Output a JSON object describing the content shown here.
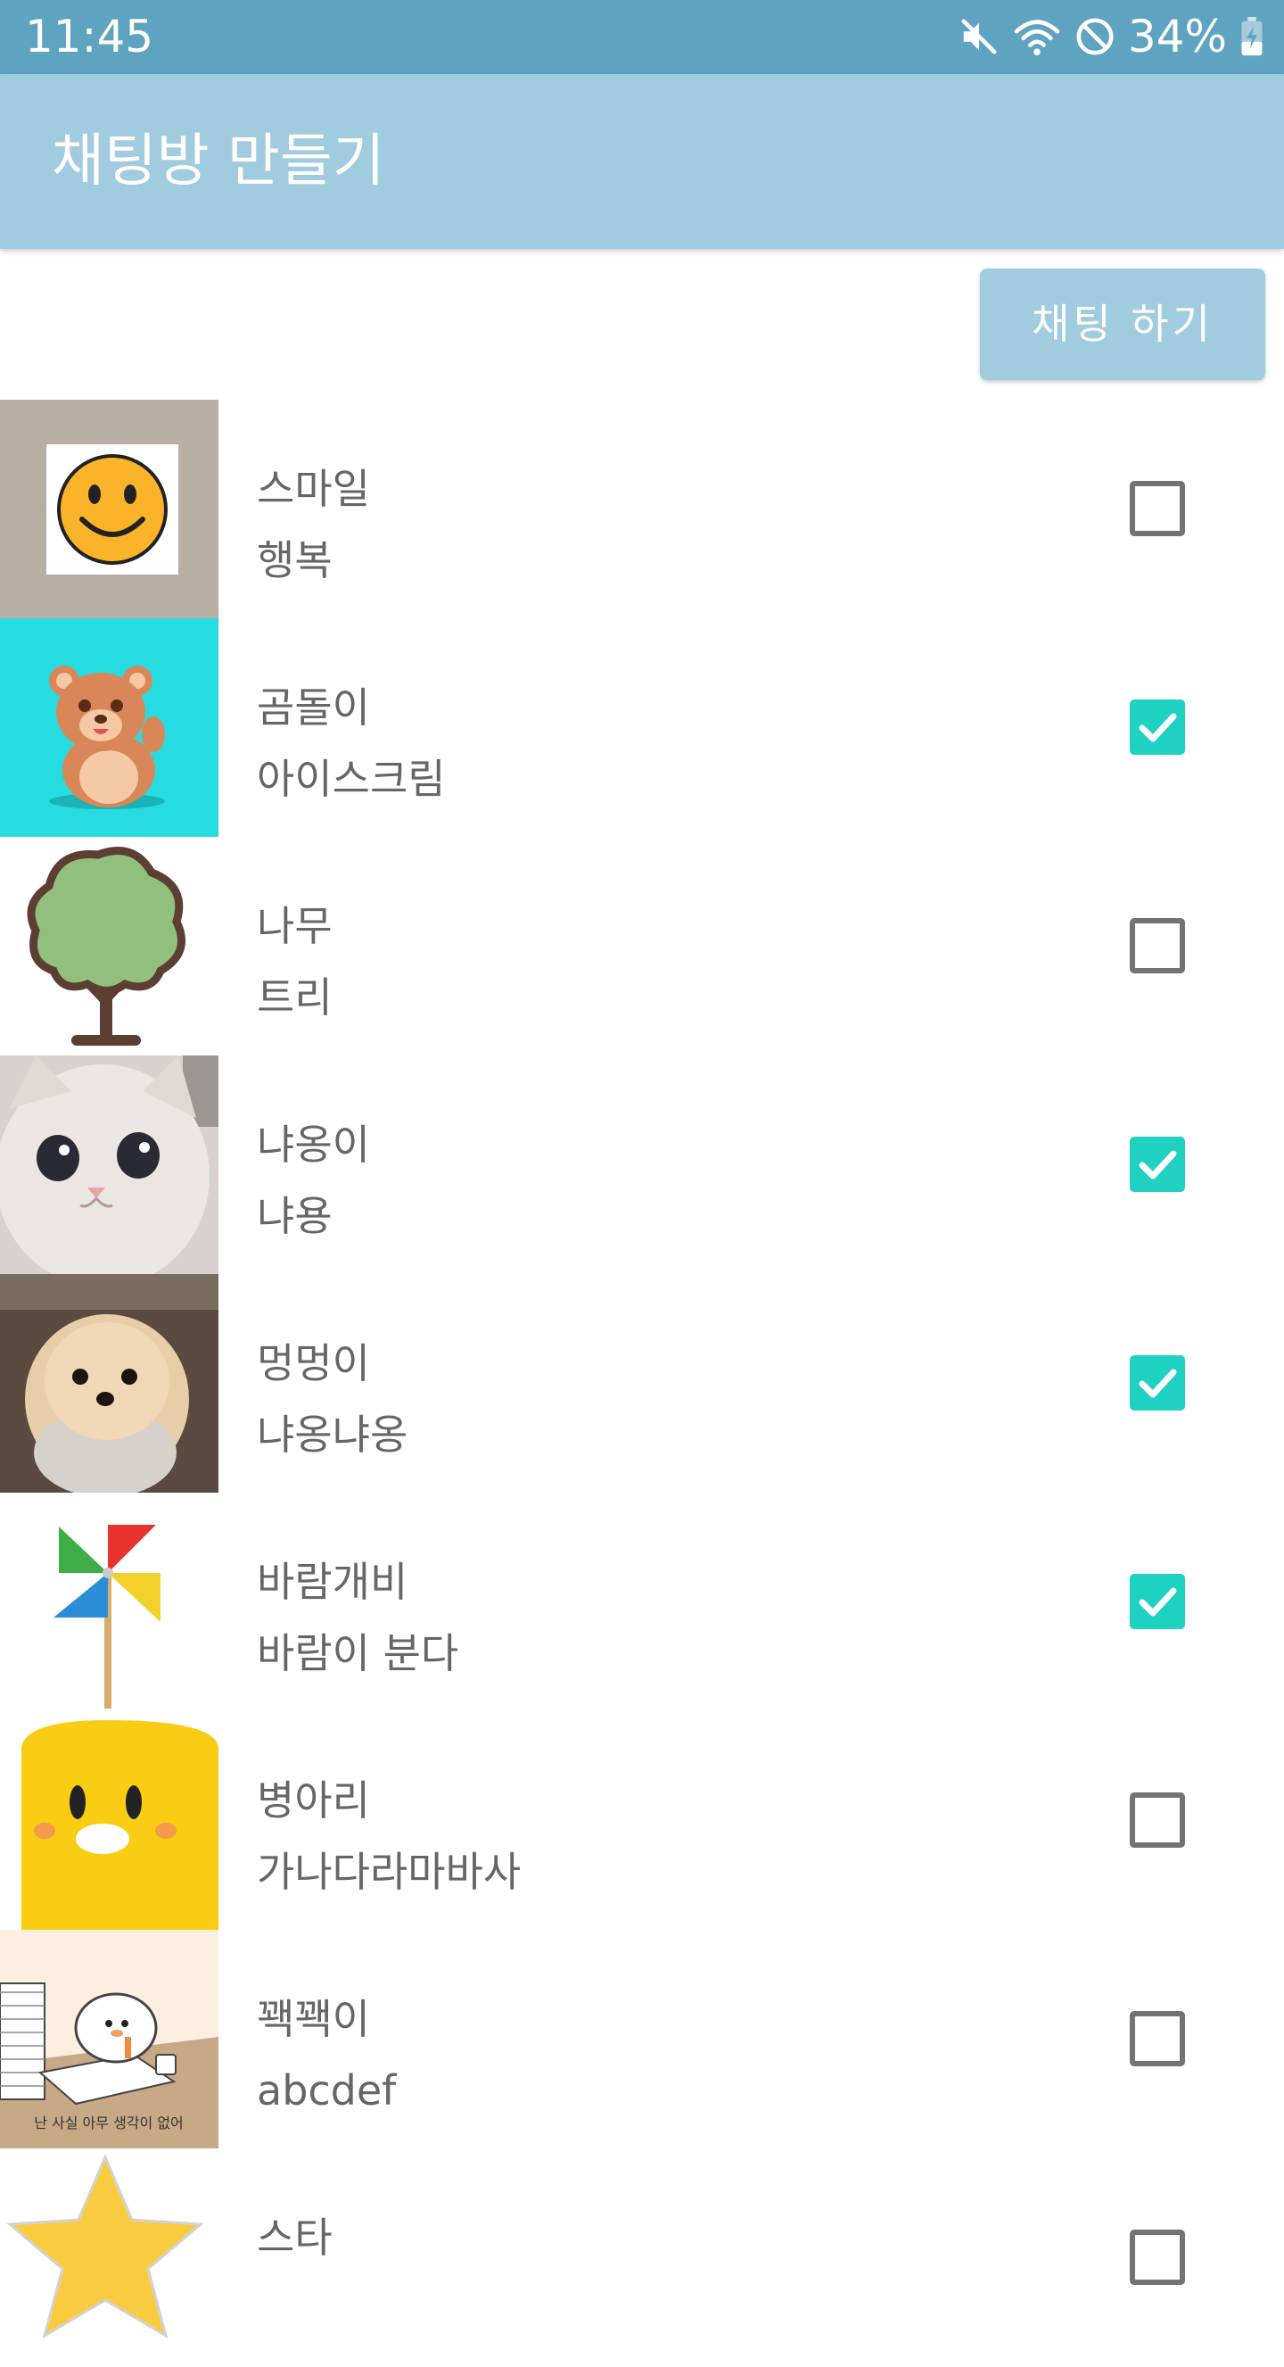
{
  "status_bar": {
    "time": "11:45",
    "battery": "34%",
    "icons": [
      "mute-icon",
      "wifi-icon",
      "block-icon",
      "battery-charging-icon"
    ]
  },
  "app_bar": {
    "title": "채팅방 만들기"
  },
  "actions": {
    "chat_button_label": "채팅 하기"
  },
  "colors": {
    "status_bar": "#5ea3c0",
    "app_bar": "#a1cce0",
    "checkbox_checked": "#1fd1c1",
    "text": "#666666"
  },
  "friends": [
    {
      "name": "스마일",
      "status": "행복",
      "checked": false,
      "avatar": "smiley-face-icon"
    },
    {
      "name": "곰돌이",
      "status": "아이스크림",
      "checked": true,
      "avatar": "teddy-bear-icon"
    },
    {
      "name": "나무",
      "status": "트리",
      "checked": false,
      "avatar": "tree-icon"
    },
    {
      "name": "냐옹이",
      "status": "냐용",
      "checked": true,
      "avatar": "cat-photo"
    },
    {
      "name": "멍멍이",
      "status": "냐옹냐옹",
      "checked": true,
      "avatar": "dog-photo"
    },
    {
      "name": "바람개비",
      "status": "바람이 분다",
      "checked": true,
      "avatar": "pinwheel-icon"
    },
    {
      "name": "병아리",
      "status": "가나다라마바사",
      "checked": false,
      "avatar": "chick-icon"
    },
    {
      "name": "꽥꽥이",
      "status": "abcdef",
      "checked": false,
      "avatar": "duck-cartoon",
      "avatar_caption": "난 사실 아무 생각이 없어"
    },
    {
      "name": "스타",
      "status": "",
      "checked": false,
      "avatar": "star-icon"
    }
  ]
}
